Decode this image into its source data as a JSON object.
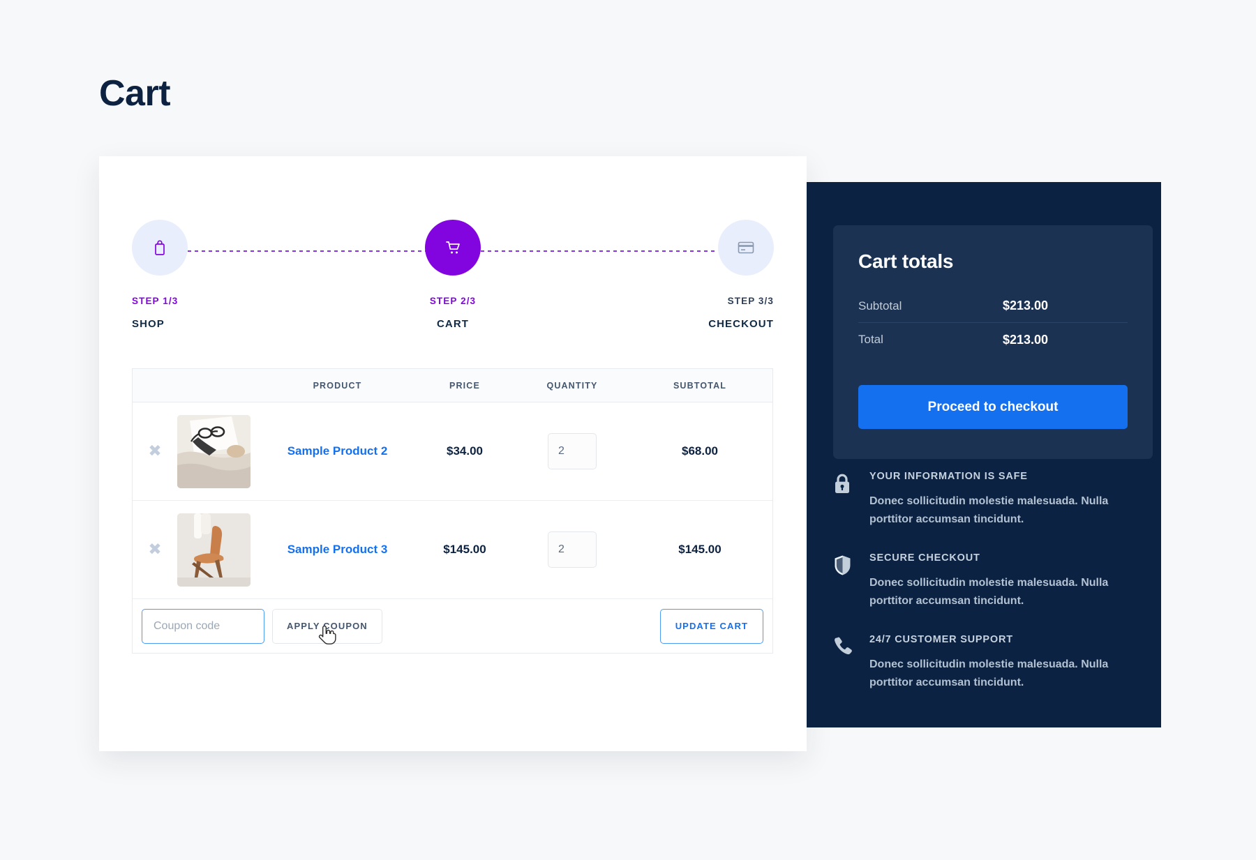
{
  "page": {
    "title": "Cart"
  },
  "colors": {
    "background": "#f7f8f9",
    "card": "#ffffff",
    "panel_dark": "#0b2242",
    "panel_inner": "#1c3252",
    "accent_purple": "#8205e0",
    "accent_blue": "#1470ef",
    "navy_text": "#0d2240",
    "step_inactive_bg": "#e8eefc"
  },
  "steps": {
    "items": [
      {
        "number": "STEP 1/3",
        "name": "SHOP",
        "icon": "shopping-bag-icon",
        "state": "complete",
        "align": "left"
      },
      {
        "number": "STEP 2/3",
        "name": "CART",
        "icon": "shopping-cart-icon",
        "state": "active",
        "align": "center"
      },
      {
        "number": "STEP 3/3",
        "name": "CHECKOUT",
        "icon": "credit-card-icon",
        "state": "upcoming",
        "align": "right"
      }
    ]
  },
  "cart_table": {
    "headers": {
      "remove": "",
      "image": "",
      "product": "PRODUCT",
      "price": "PRICE",
      "quantity": "QUANTITY",
      "subtotal": "SUBTOTAL"
    },
    "remove_glyph": "✖",
    "rows": [
      {
        "name": "Sample Product 2",
        "price": "$34.00",
        "quantity": "2",
        "subtotal": "$68.00",
        "thumb_alt": "eyeglasses-on-notebook-photo"
      },
      {
        "name": "Sample Product 3",
        "price": "$145.00",
        "quantity": "2",
        "subtotal": "$145.00",
        "thumb_alt": "leather-chair-photo"
      }
    ],
    "coupon": {
      "placeholder": "Coupon code",
      "value": "",
      "apply_label": "APPLY COUPON",
      "update_label": "UPDATE CART"
    }
  },
  "cart_totals": {
    "title": "Cart totals",
    "lines": [
      {
        "label": "Subtotal",
        "value": "$213.00"
      },
      {
        "label": "Total",
        "value": "$213.00"
      }
    ],
    "checkout_label": "Proceed to checkout"
  },
  "trust_badges": [
    {
      "icon": "lock-icon",
      "title": "YOUR INFORMATION IS SAFE",
      "text": "Donec sollicitudin molestie malesuada. Nulla porttitor accumsan tincidunt."
    },
    {
      "icon": "shield-icon",
      "title": "SECURE CHECKOUT",
      "text": "Donec sollicitudin molestie malesuada. Nulla porttitor accumsan tincidunt."
    },
    {
      "icon": "phone-icon",
      "title": "24/7 CUSTOMER SUPPORT",
      "text": "Donec sollicitudin molestie malesuada. Nulla porttitor accumsan tincidunt."
    }
  ],
  "cursor": {
    "type": "pointer-hand"
  }
}
